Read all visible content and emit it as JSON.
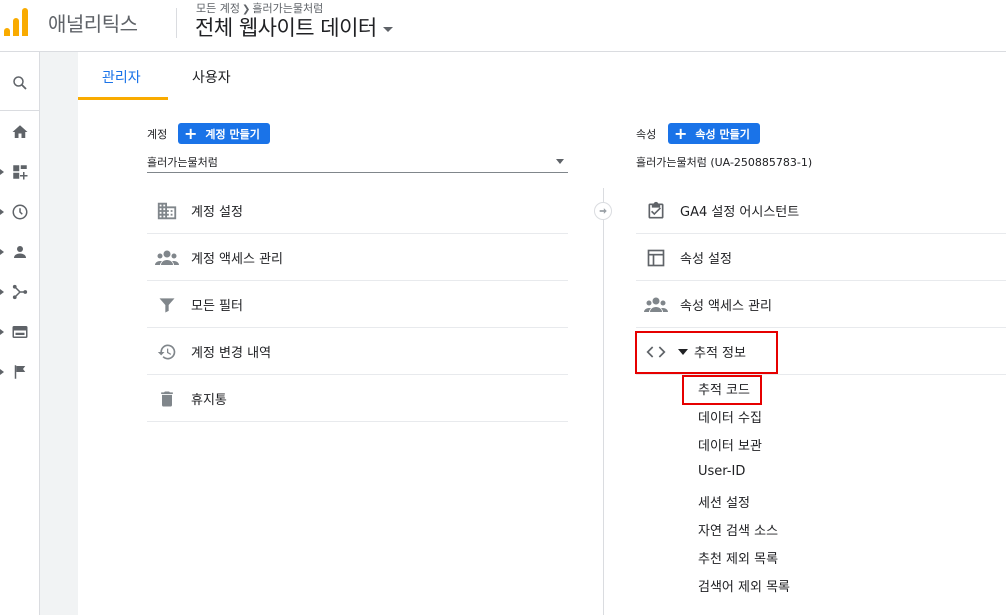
{
  "header": {
    "app_title": "애널리틱스",
    "breadcrumb_account": "모든 계정",
    "breadcrumb_property": "흘러가는물처럼",
    "view_title": "전체 웹사이트 데이터"
  },
  "sidebar": {
    "icons": [
      "search-icon",
      "home-icon",
      "customization-icon",
      "realtime-icon",
      "audience-icon",
      "acquisition-icon",
      "behavior-icon",
      "conversions-icon"
    ]
  },
  "tabs": [
    {
      "label": "관리자",
      "active": true
    },
    {
      "label": "사용자",
      "active": false
    }
  ],
  "account": {
    "label": "계정",
    "create_button": "계정 만들기",
    "selected": "흘러가는물처럼",
    "menu": [
      {
        "icon": "building-icon",
        "label": "계정 설정"
      },
      {
        "icon": "people-icon",
        "label": "계정 액세스 관리"
      },
      {
        "icon": "filter-icon",
        "label": "모든 필터"
      },
      {
        "icon": "history-icon",
        "label": "계정 변경 내역"
      },
      {
        "icon": "trash-icon",
        "label": "휴지통"
      }
    ]
  },
  "property": {
    "label": "속성",
    "create_button": "속성 만들기",
    "selected": "흘러가는물처럼 (UA-250885783-1)",
    "menu": [
      {
        "icon": "checklist-icon",
        "label": "GA4 설정 어시스턴트"
      },
      {
        "icon": "layout-icon",
        "label": "속성 설정"
      },
      {
        "icon": "people-icon",
        "label": "속성 액세스 관리"
      },
      {
        "icon": "code-icon",
        "label": "추적 정보"
      }
    ],
    "tracking_sub": [
      "추적 코드",
      "데이터 수집",
      "데이터 보관",
      "User-ID",
      "세션 설정",
      "자연 검색 소스",
      "추천 제외 목록",
      "검색어 제외 목록"
    ]
  },
  "colors": {
    "accent": "#1a73e8",
    "tab_underline": "#f9ab00",
    "highlight": "#e60000"
  }
}
